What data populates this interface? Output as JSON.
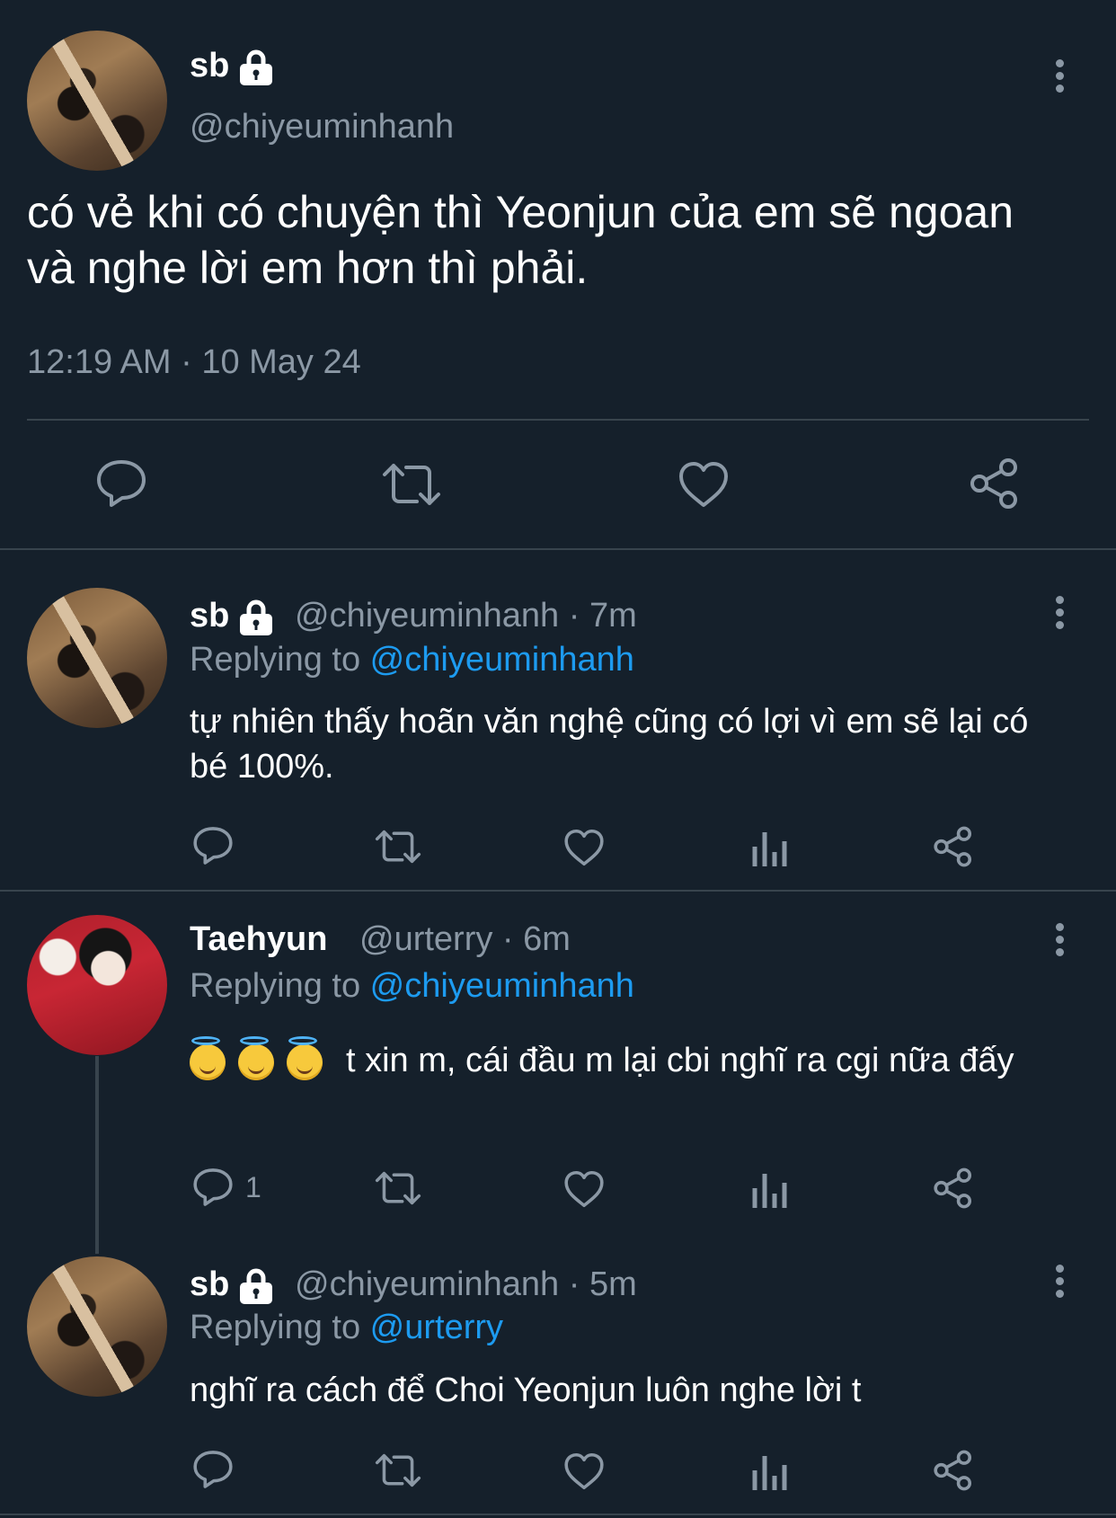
{
  "main_tweet": {
    "name": "sb",
    "handle": "@chiyeuminhanh",
    "text": "có vẻ khi có chuyện thì Yeonjun của em sẽ ngoan và nghe lời em hơn thì phải.",
    "timestamp": "12:19 AM · 10 May 24"
  },
  "replies": [
    {
      "name": "sb",
      "handle": "@chiyeuminhanh · 7m",
      "replying_label": "Replying to ",
      "replying_to": "@chiyeuminhanh",
      "text": "tự nhiên thấy hoãn văn nghệ cũng có lợi vì em sẽ lại có bé 100%.",
      "reply_count": ""
    },
    {
      "name": "Taehyun",
      "handle": "@urterry · 6m",
      "replying_label": "Replying to ",
      "replying_to": "@chiyeuminhanh",
      "text": "t xin m, cái đầu m lại cbi nghĩ ra cgi nữa đấy",
      "emoji": [
        "smiling-face-with-halo",
        "smiling-face-with-halo",
        "smiling-face-with-halo"
      ],
      "reply_count": "1"
    },
    {
      "name": "sb",
      "handle": "@chiyeuminhanh · 5m",
      "replying_label": "Replying to ",
      "replying_to": "@urterry",
      "text": "nghĩ ra cách để Choi Yeonjun luôn nghe lời t",
      "reply_count": ""
    }
  ],
  "colors": {
    "background": "#15202b",
    "text": "#ffffff",
    "secondary": "#8b98a5",
    "link": "#1d9bf0",
    "divider": "#38444d"
  }
}
